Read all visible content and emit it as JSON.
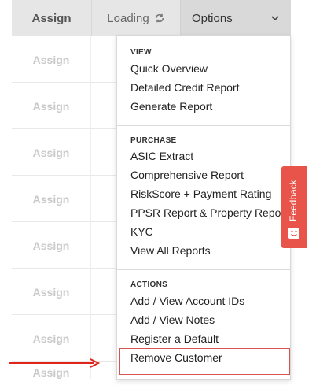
{
  "header": {
    "assign_label": "Assign",
    "loading_label": "Loading",
    "options_label": "Options"
  },
  "rows": [
    {
      "assign": "Assign"
    },
    {
      "assign": "Assign"
    },
    {
      "assign": "Assign"
    },
    {
      "assign": "Assign"
    },
    {
      "assign": "Assign"
    },
    {
      "assign": "Assign"
    },
    {
      "assign": "Assign"
    },
    {
      "assign": "Assign"
    }
  ],
  "menu": {
    "view_title": "VIEW",
    "view_items": [
      "Quick Overview",
      "Detailed Credit Report",
      "Generate Report"
    ],
    "purchase_title": "PURCHASE",
    "purchase_items": [
      "ASIC Extract",
      "Comprehensive Report",
      "RiskScore + Payment Rating",
      "PPSR Report & Property Report",
      "KYC",
      "View All Reports"
    ],
    "actions_title": "ACTIONS",
    "actions_items": [
      "Add / View Account IDs",
      "Add / View Notes",
      "Register a Default",
      "Remove Customer"
    ]
  },
  "feedback": {
    "label": "Feedback"
  },
  "colors": {
    "highlight": "#d9534f",
    "feedback": "#e8534a",
    "arrow": "#e0251b"
  }
}
